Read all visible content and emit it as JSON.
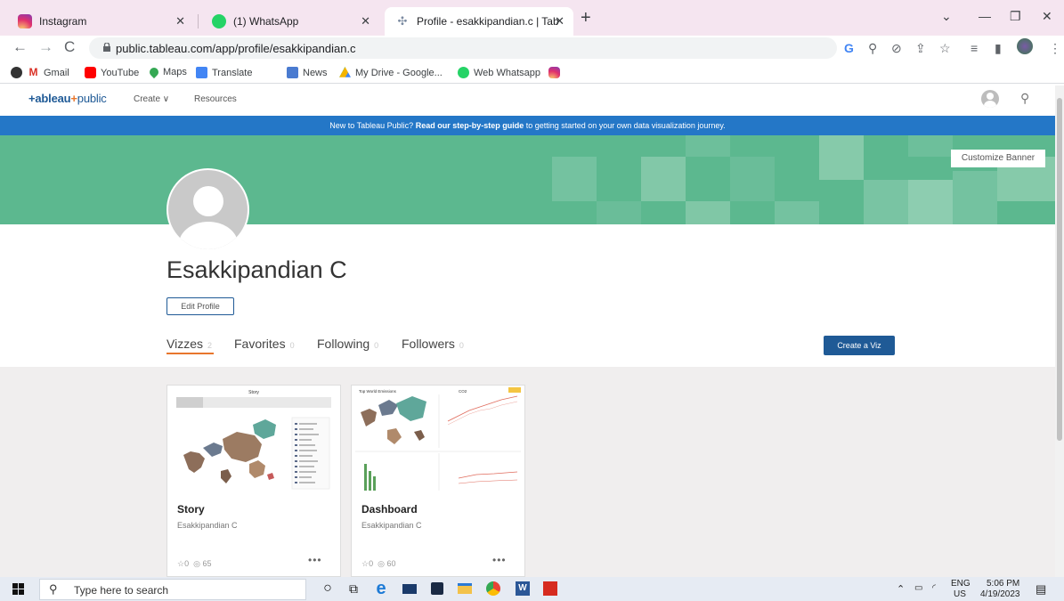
{
  "browser": {
    "tabs": [
      {
        "title": "Instagram",
        "icon": "instagram-icon"
      },
      {
        "title": "(1) WhatsApp",
        "icon": "whatsapp-icon"
      },
      {
        "title": "Profile - esakkipandian.c | Tablea",
        "icon": "tableau-icon"
      }
    ],
    "url": "public.tableau.com/app/profile/esakkipandian.c",
    "bookmarks": [
      {
        "label": "",
        "icon": "chrome-web-store-icon"
      },
      {
        "label": "Gmail",
        "icon": "gmail-icon"
      },
      {
        "label": "YouTube",
        "icon": "youtube-icon"
      },
      {
        "label": "Maps",
        "icon": "maps-icon"
      },
      {
        "label": "Translate",
        "icon": "translate-icon"
      },
      {
        "label": "News",
        "icon": "news-icon"
      },
      {
        "label": "My Drive - Google...",
        "icon": "drive-icon"
      },
      {
        "label": "Web Whatsapp",
        "icon": "whatsapp-icon"
      },
      {
        "label": "",
        "icon": "instagram-icon"
      }
    ]
  },
  "site": {
    "logo_main": "+ableau",
    "logo_sep": "+",
    "logo_pub": "public",
    "nav_create": "Create ∨",
    "nav_resources": "Resources",
    "banner_pre": "New to Tableau Public? ",
    "banner_link": "Read our step-by-step guide",
    "banner_post": " to getting started on your own data visualization journey.",
    "customize_banner": "Customize Banner"
  },
  "profile": {
    "name": "Esakkipandian C",
    "edit_profile": "Edit Profile",
    "tabs": [
      {
        "label": "Vizzes",
        "count": "2"
      },
      {
        "label": "Favorites",
        "count": "0"
      },
      {
        "label": "Following",
        "count": "0"
      },
      {
        "label": "Followers",
        "count": "0"
      }
    ],
    "create_viz": "Create a Viz"
  },
  "vizzes": [
    {
      "title": "Story",
      "author": "Esakkipandian C",
      "favorites": "0",
      "views": "65",
      "more": "•••",
      "thumb_title": "Story"
    },
    {
      "title": "Dashboard",
      "author": "Esakkipandian C",
      "favorites": "0",
      "views": "60",
      "more": "•••",
      "thumb_title": "Top World Emissions"
    }
  ],
  "taskbar": {
    "search_placeholder": "Type here to search",
    "lang_top": "ENG",
    "lang_bottom": "US",
    "time": "5:06 PM",
    "date": "4/19/2023"
  },
  "colors": {
    "cover": "#5cb88f",
    "banner": "#2477c7",
    "accent": "#e8762d",
    "brand": "#1f5a96"
  }
}
